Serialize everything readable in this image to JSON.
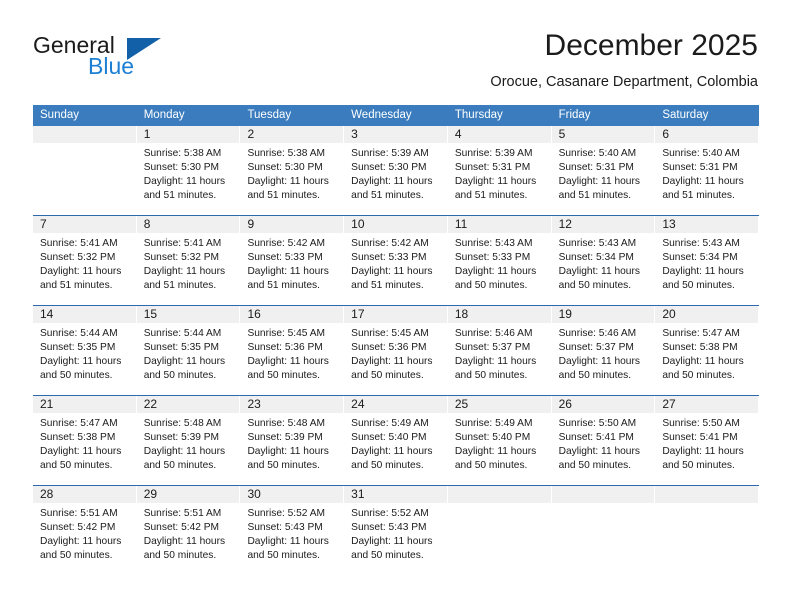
{
  "brand": {
    "name_part1": "General",
    "name_part2": "Blue",
    "triangle_icon": "triangle-icon",
    "accent_dark": "#1160a8",
    "accent_blue": "#1c7fd4"
  },
  "header": {
    "title": "December 2025",
    "subtitle": "Orocue, Casanare Department, Colombia"
  },
  "theme": {
    "header_row_bg": "#3a7cbe",
    "day_number_bg": "#f0f0f0",
    "week_divider": "#2a6aad",
    "text": "#1b1b1b"
  },
  "weekdays": [
    "Sunday",
    "Monday",
    "Tuesday",
    "Wednesday",
    "Thursday",
    "Friday",
    "Saturday"
  ],
  "weeks": [
    [
      {
        "day": "",
        "sunrise": "",
        "sunset": "",
        "daylight_line1": "",
        "daylight_line2": "",
        "empty": true
      },
      {
        "day": "1",
        "sunrise": "Sunrise: 5:38 AM",
        "sunset": "Sunset: 5:30 PM",
        "daylight_line1": "Daylight: 11 hours",
        "daylight_line2": "and 51 minutes.",
        "empty": false
      },
      {
        "day": "2",
        "sunrise": "Sunrise: 5:38 AM",
        "sunset": "Sunset: 5:30 PM",
        "daylight_line1": "Daylight: 11 hours",
        "daylight_line2": "and 51 minutes.",
        "empty": false
      },
      {
        "day": "3",
        "sunrise": "Sunrise: 5:39 AM",
        "sunset": "Sunset: 5:30 PM",
        "daylight_line1": "Daylight: 11 hours",
        "daylight_line2": "and 51 minutes.",
        "empty": false
      },
      {
        "day": "4",
        "sunrise": "Sunrise: 5:39 AM",
        "sunset": "Sunset: 5:31 PM",
        "daylight_line1": "Daylight: 11 hours",
        "daylight_line2": "and 51 minutes.",
        "empty": false
      },
      {
        "day": "5",
        "sunrise": "Sunrise: 5:40 AM",
        "sunset": "Sunset: 5:31 PM",
        "daylight_line1": "Daylight: 11 hours",
        "daylight_line2": "and 51 minutes.",
        "empty": false
      },
      {
        "day": "6",
        "sunrise": "Sunrise: 5:40 AM",
        "sunset": "Sunset: 5:31 PM",
        "daylight_line1": "Daylight: 11 hours",
        "daylight_line2": "and 51 minutes.",
        "empty": false
      }
    ],
    [
      {
        "day": "7",
        "sunrise": "Sunrise: 5:41 AM",
        "sunset": "Sunset: 5:32 PM",
        "daylight_line1": "Daylight: 11 hours",
        "daylight_line2": "and 51 minutes.",
        "empty": false
      },
      {
        "day": "8",
        "sunrise": "Sunrise: 5:41 AM",
        "sunset": "Sunset: 5:32 PM",
        "daylight_line1": "Daylight: 11 hours",
        "daylight_line2": "and 51 minutes.",
        "empty": false
      },
      {
        "day": "9",
        "sunrise": "Sunrise: 5:42 AM",
        "sunset": "Sunset: 5:33 PM",
        "daylight_line1": "Daylight: 11 hours",
        "daylight_line2": "and 51 minutes.",
        "empty": false
      },
      {
        "day": "10",
        "sunrise": "Sunrise: 5:42 AM",
        "sunset": "Sunset: 5:33 PM",
        "daylight_line1": "Daylight: 11 hours",
        "daylight_line2": "and 51 minutes.",
        "empty": false
      },
      {
        "day": "11",
        "sunrise": "Sunrise: 5:43 AM",
        "sunset": "Sunset: 5:33 PM",
        "daylight_line1": "Daylight: 11 hours",
        "daylight_line2": "and 50 minutes.",
        "empty": false
      },
      {
        "day": "12",
        "sunrise": "Sunrise: 5:43 AM",
        "sunset": "Sunset: 5:34 PM",
        "daylight_line1": "Daylight: 11 hours",
        "daylight_line2": "and 50 minutes.",
        "empty": false
      },
      {
        "day": "13",
        "sunrise": "Sunrise: 5:43 AM",
        "sunset": "Sunset: 5:34 PM",
        "daylight_line1": "Daylight: 11 hours",
        "daylight_line2": "and 50 minutes.",
        "empty": false
      }
    ],
    [
      {
        "day": "14",
        "sunrise": "Sunrise: 5:44 AM",
        "sunset": "Sunset: 5:35 PM",
        "daylight_line1": "Daylight: 11 hours",
        "daylight_line2": "and 50 minutes.",
        "empty": false
      },
      {
        "day": "15",
        "sunrise": "Sunrise: 5:44 AM",
        "sunset": "Sunset: 5:35 PM",
        "daylight_line1": "Daylight: 11 hours",
        "daylight_line2": "and 50 minutes.",
        "empty": false
      },
      {
        "day": "16",
        "sunrise": "Sunrise: 5:45 AM",
        "sunset": "Sunset: 5:36 PM",
        "daylight_line1": "Daylight: 11 hours",
        "daylight_line2": "and 50 minutes.",
        "empty": false
      },
      {
        "day": "17",
        "sunrise": "Sunrise: 5:45 AM",
        "sunset": "Sunset: 5:36 PM",
        "daylight_line1": "Daylight: 11 hours",
        "daylight_line2": "and 50 minutes.",
        "empty": false
      },
      {
        "day": "18",
        "sunrise": "Sunrise: 5:46 AM",
        "sunset": "Sunset: 5:37 PM",
        "daylight_line1": "Daylight: 11 hours",
        "daylight_line2": "and 50 minutes.",
        "empty": false
      },
      {
        "day": "19",
        "sunrise": "Sunrise: 5:46 AM",
        "sunset": "Sunset: 5:37 PM",
        "daylight_line1": "Daylight: 11 hours",
        "daylight_line2": "and 50 minutes.",
        "empty": false
      },
      {
        "day": "20",
        "sunrise": "Sunrise: 5:47 AM",
        "sunset": "Sunset: 5:38 PM",
        "daylight_line1": "Daylight: 11 hours",
        "daylight_line2": "and 50 minutes.",
        "empty": false
      }
    ],
    [
      {
        "day": "21",
        "sunrise": "Sunrise: 5:47 AM",
        "sunset": "Sunset: 5:38 PM",
        "daylight_line1": "Daylight: 11 hours",
        "daylight_line2": "and 50 minutes.",
        "empty": false
      },
      {
        "day": "22",
        "sunrise": "Sunrise: 5:48 AM",
        "sunset": "Sunset: 5:39 PM",
        "daylight_line1": "Daylight: 11 hours",
        "daylight_line2": "and 50 minutes.",
        "empty": false
      },
      {
        "day": "23",
        "sunrise": "Sunrise: 5:48 AM",
        "sunset": "Sunset: 5:39 PM",
        "daylight_line1": "Daylight: 11 hours",
        "daylight_line2": "and 50 minutes.",
        "empty": false
      },
      {
        "day": "24",
        "sunrise": "Sunrise: 5:49 AM",
        "sunset": "Sunset: 5:40 PM",
        "daylight_line1": "Daylight: 11 hours",
        "daylight_line2": "and 50 minutes.",
        "empty": false
      },
      {
        "day": "25",
        "sunrise": "Sunrise: 5:49 AM",
        "sunset": "Sunset: 5:40 PM",
        "daylight_line1": "Daylight: 11 hours",
        "daylight_line2": "and 50 minutes.",
        "empty": false
      },
      {
        "day": "26",
        "sunrise": "Sunrise: 5:50 AM",
        "sunset": "Sunset: 5:41 PM",
        "daylight_line1": "Daylight: 11 hours",
        "daylight_line2": "and 50 minutes.",
        "empty": false
      },
      {
        "day": "27",
        "sunrise": "Sunrise: 5:50 AM",
        "sunset": "Sunset: 5:41 PM",
        "daylight_line1": "Daylight: 11 hours",
        "daylight_line2": "and 50 minutes.",
        "empty": false
      }
    ],
    [
      {
        "day": "28",
        "sunrise": "Sunrise: 5:51 AM",
        "sunset": "Sunset: 5:42 PM",
        "daylight_line1": "Daylight: 11 hours",
        "daylight_line2": "and 50 minutes.",
        "empty": false
      },
      {
        "day": "29",
        "sunrise": "Sunrise: 5:51 AM",
        "sunset": "Sunset: 5:42 PM",
        "daylight_line1": "Daylight: 11 hours",
        "daylight_line2": "and 50 minutes.",
        "empty": false
      },
      {
        "day": "30",
        "sunrise": "Sunrise: 5:52 AM",
        "sunset": "Sunset: 5:43 PM",
        "daylight_line1": "Daylight: 11 hours",
        "daylight_line2": "and 50 minutes.",
        "empty": false
      },
      {
        "day": "31",
        "sunrise": "Sunrise: 5:52 AM",
        "sunset": "Sunset: 5:43 PM",
        "daylight_line1": "Daylight: 11 hours",
        "daylight_line2": "and 50 minutes.",
        "empty": false
      },
      {
        "day": "",
        "sunrise": "",
        "sunset": "",
        "daylight_line1": "",
        "daylight_line2": "",
        "empty": true
      },
      {
        "day": "",
        "sunrise": "",
        "sunset": "",
        "daylight_line1": "",
        "daylight_line2": "",
        "empty": true
      },
      {
        "day": "",
        "sunrise": "",
        "sunset": "",
        "daylight_line1": "",
        "daylight_line2": "",
        "empty": true
      }
    ]
  ]
}
